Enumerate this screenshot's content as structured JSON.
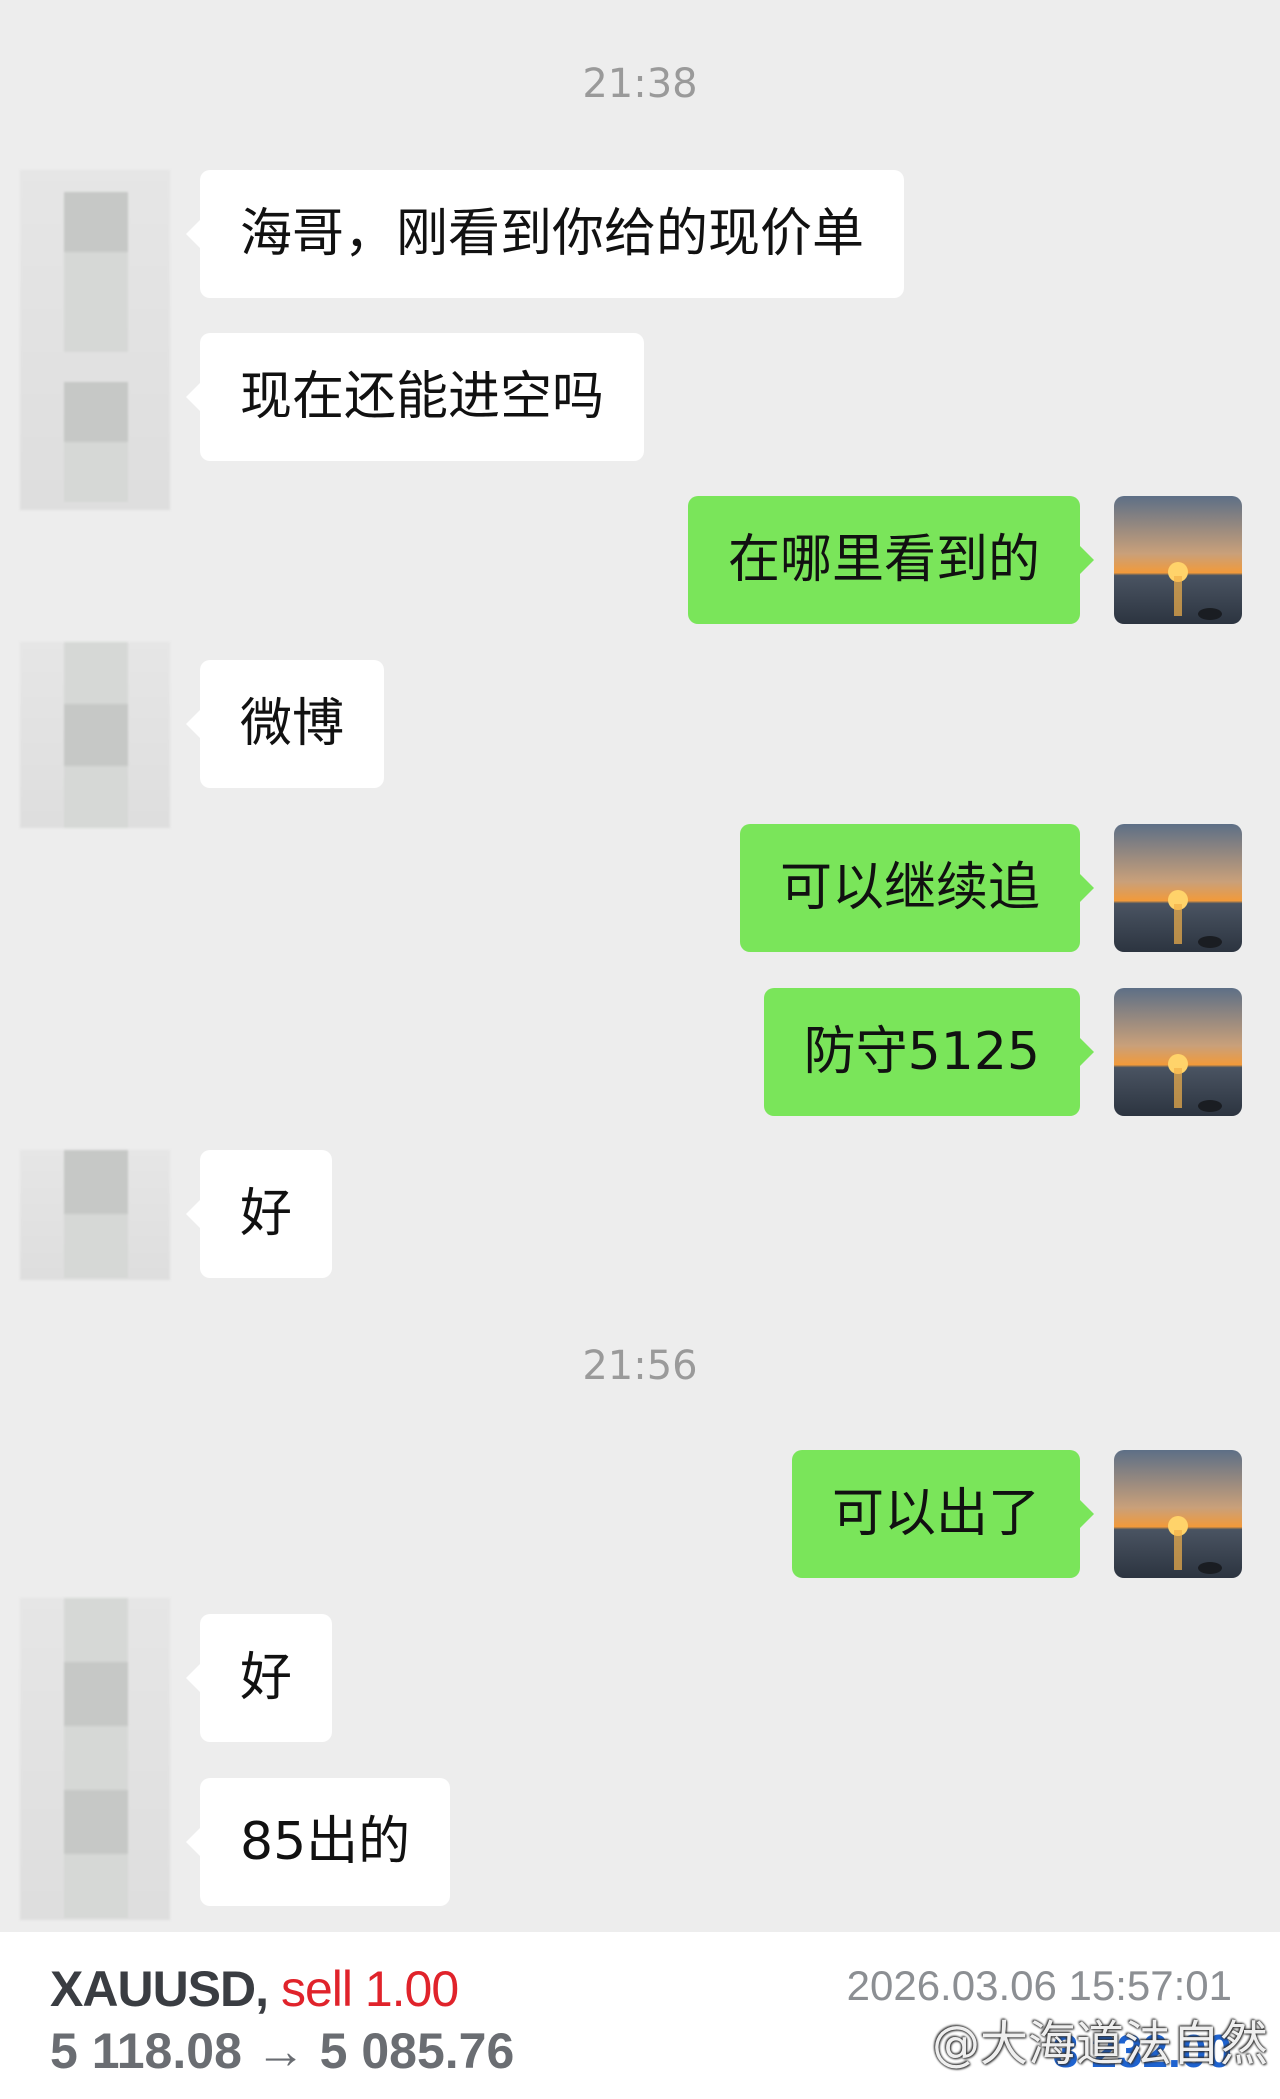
{
  "timestamps": [
    "21:38",
    "21:56"
  ],
  "messages": [
    {
      "side": "in",
      "text": "海哥，刚看到你给的现价单"
    },
    {
      "side": "in",
      "text": "现在还能进空吗"
    },
    {
      "side": "out",
      "text": "在哪里看到的"
    },
    {
      "side": "in",
      "text": "微博"
    },
    {
      "side": "out",
      "text": "可以继续追"
    },
    {
      "side": "out",
      "text": "防守5125"
    },
    {
      "side": "in",
      "text": "好"
    },
    {
      "side": "out",
      "text": "可以出了"
    },
    {
      "side": "in",
      "text": "好"
    },
    {
      "side": "in",
      "text": "85出的"
    }
  ],
  "trade": {
    "symbol": "XAUUSD,",
    "side": "sell 1.00",
    "prices": "5 118.08 → 5 085.76",
    "datetime": "2026.03.06 15:57:01",
    "profit": "3 232.00"
  },
  "watermark": "@大海道法自然",
  "icons": {
    "my_avatar": "sunset-avatar-icon",
    "contact_avatar": "blurred-avatar-icon"
  },
  "colors": {
    "background": "#ededed",
    "outgoing_bubble": "#7ae55a",
    "incoming_bubble": "#ffffff",
    "sell": "#e0232b",
    "profit": "#1e63d0"
  }
}
